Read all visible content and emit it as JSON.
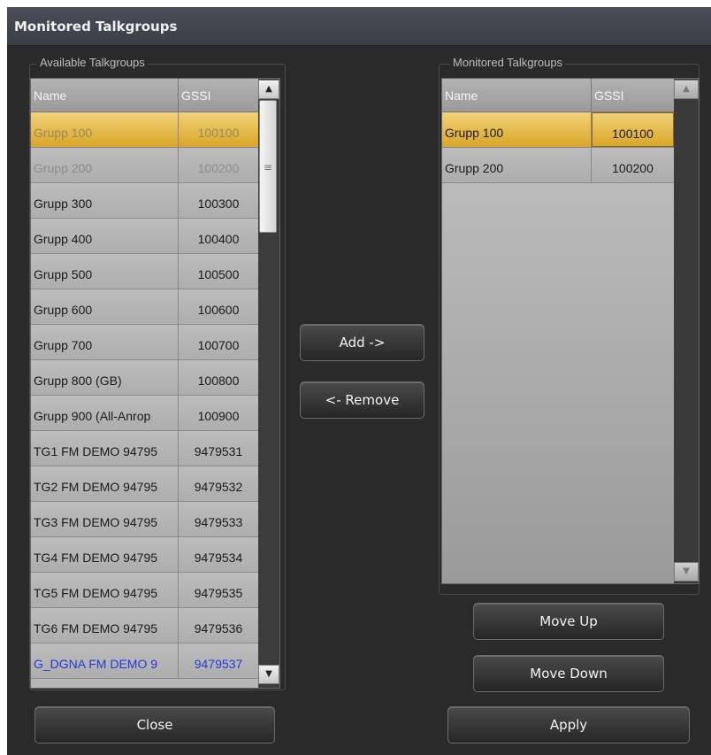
{
  "window": {
    "title": "Monitored Talkgroups"
  },
  "available": {
    "label": "Available Talkgroups",
    "col_name": "Name",
    "col_gssi": "GSSI",
    "rows": [
      {
        "name": "Grupp 100",
        "gssi": "100100"
      },
      {
        "name": "Grupp 200",
        "gssi": "100200"
      },
      {
        "name": "Grupp 300",
        "gssi": "100300"
      },
      {
        "name": "Grupp 400",
        "gssi": "100400"
      },
      {
        "name": "Grupp 500",
        "gssi": "100500"
      },
      {
        "name": "Grupp 600",
        "gssi": "100600"
      },
      {
        "name": "Grupp 700",
        "gssi": "100700"
      },
      {
        "name": "Grupp 800 (GB)",
        "gssi": "100800"
      },
      {
        "name": "Grupp 900 (All-Anrop",
        "gssi": "100900"
      },
      {
        "name": "TG1 FM DEMO 94795",
        "gssi": "9479531"
      },
      {
        "name": "TG2 FM DEMO 94795",
        "gssi": "9479532"
      },
      {
        "name": "TG3 FM DEMO 94795",
        "gssi": "9479533"
      },
      {
        "name": "TG4 FM DEMO 94795",
        "gssi": "9479534"
      },
      {
        "name": "TG5 FM DEMO 94795",
        "gssi": "9479535"
      },
      {
        "name": "TG6 FM DEMO 94795",
        "gssi": "9479536"
      },
      {
        "name": "G_DGNA FM DEMO 9",
        "gssi": "9479537"
      }
    ]
  },
  "monitored": {
    "label": "Monitored Talkgroups",
    "col_name": "Name",
    "col_gssi": "GSSI",
    "rows": [
      {
        "name": "Grupp 100",
        "gssi": "100100"
      },
      {
        "name": "Grupp 200",
        "gssi": "100200"
      }
    ]
  },
  "buttons": {
    "add": "Add ->",
    "remove": "<- Remove",
    "move_up": "Move Up",
    "move_down": "Move Down",
    "close": "Close",
    "apply": "Apply"
  },
  "icons": {
    "scroll_up": "triangle-up",
    "scroll_down": "triangle-down",
    "scroll_grip": "grip-lines"
  },
  "colors": {
    "selected_row": "#e8bd48",
    "link_text": "#2a37d6",
    "panel_bg": "#2a2a2a"
  }
}
